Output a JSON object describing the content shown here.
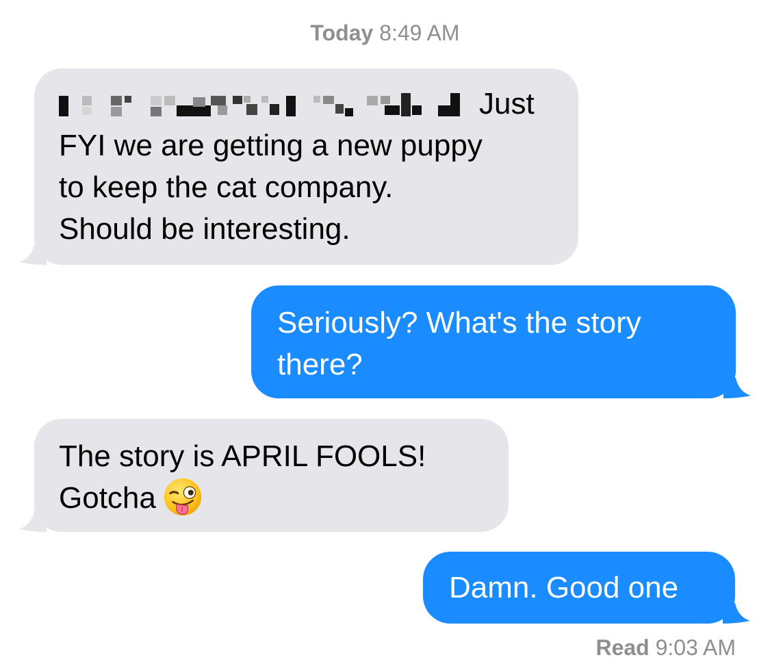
{
  "header": {
    "day": "Today",
    "time": "8:49 AM"
  },
  "messages": [
    {
      "direction": "incoming",
      "redacted_prefix": true,
      "lines": [
        "Just",
        "FYI we are getting a new puppy",
        "to keep the cat company.",
        "Should be interesting."
      ]
    },
    {
      "direction": "outgoing",
      "lines": [
        "Seriously? What's the story",
        "there?"
      ]
    },
    {
      "direction": "incoming",
      "lines": [
        "The story is APRIL FOOLS!",
        "Gotcha"
      ],
      "emoji": "winking-face-with-tongue"
    },
    {
      "direction": "outgoing",
      "lines": [
        "Damn. Good one"
      ]
    }
  ],
  "receipt": {
    "label": "Read",
    "time": "9:03 AM"
  },
  "colors": {
    "incoming_bubble": "#e5e5ea",
    "outgoing_bubble": "#1a8cff",
    "meta_text": "#8e8e93"
  }
}
